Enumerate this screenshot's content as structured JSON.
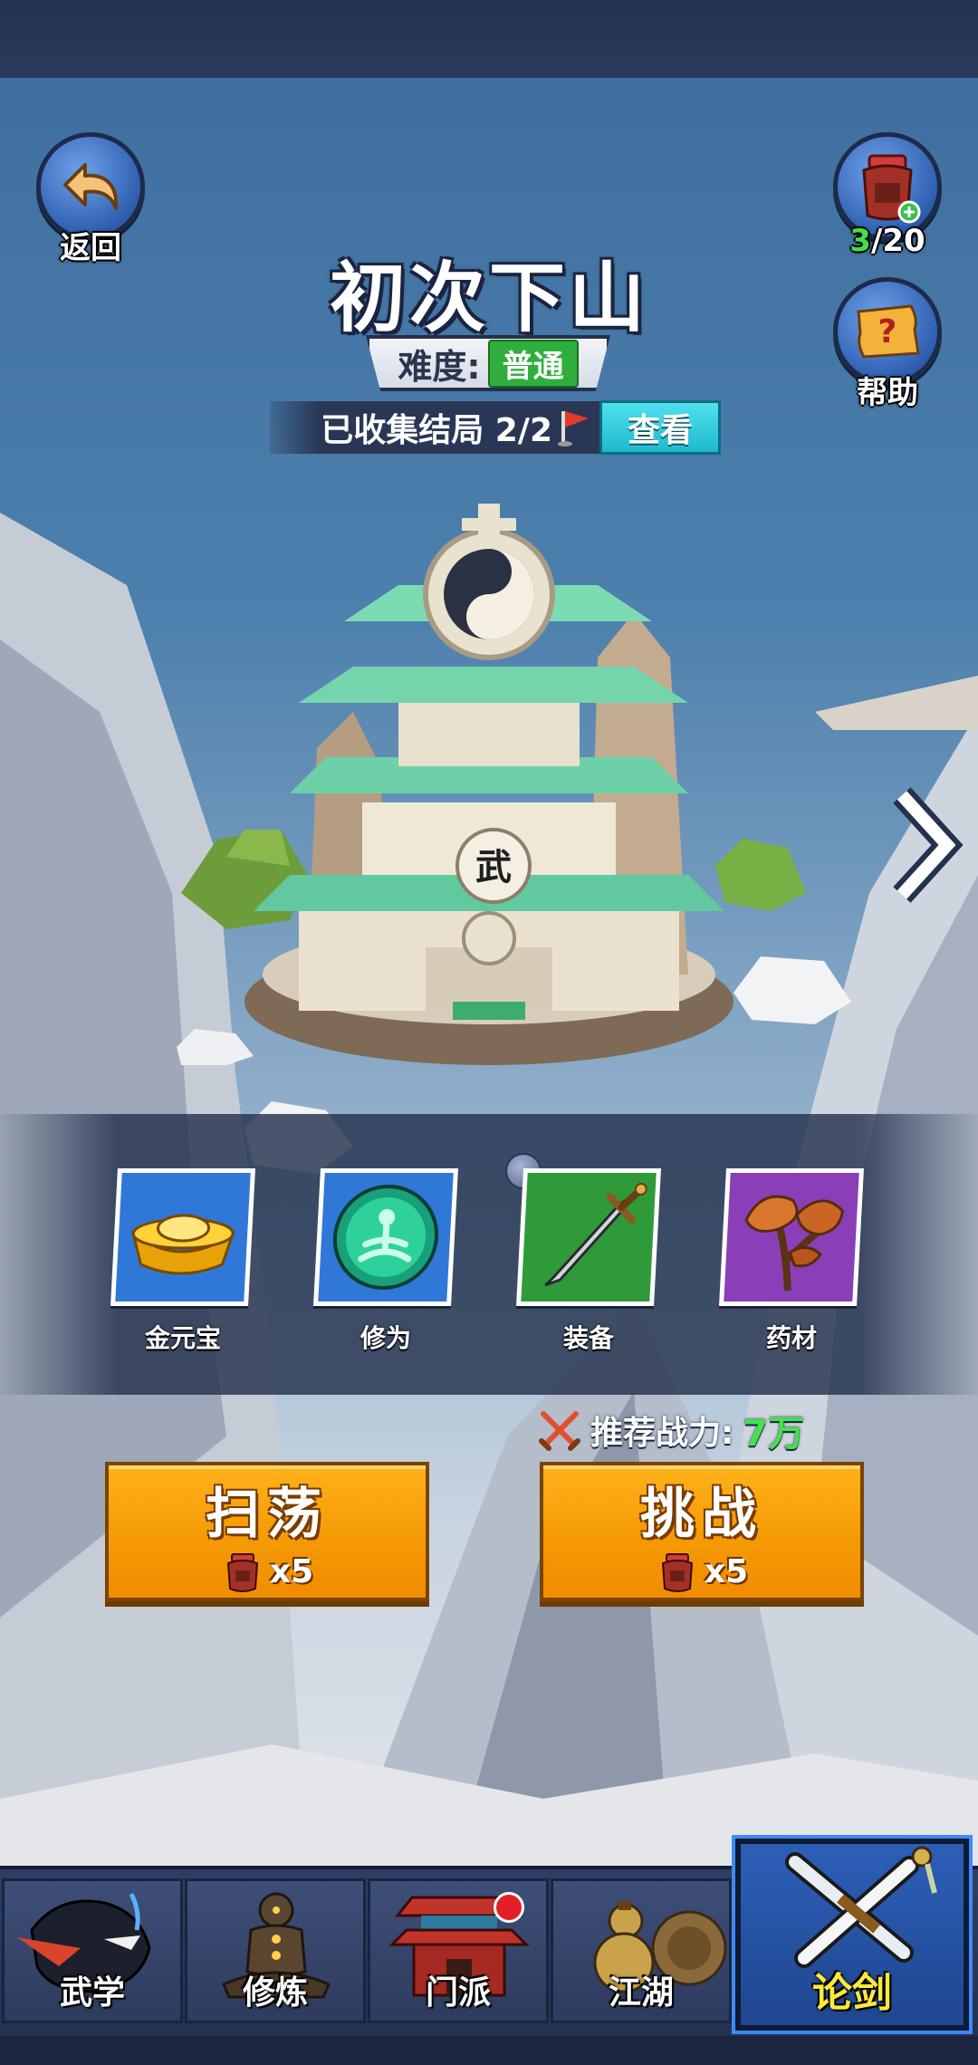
{
  "header": {
    "back_label": "返回",
    "stamina": {
      "current": "3",
      "max": "/20"
    },
    "help_label": "帮助"
  },
  "stage": {
    "title": "初次下山",
    "difficulty_label": "难度:",
    "difficulty_value": "普通",
    "collection_text": "已收集结局 2/2",
    "view_button": "查看",
    "temple_sign": "武"
  },
  "rewards": [
    {
      "name": "金元宝",
      "icon": "gold-ingot-icon",
      "bg": "#2f78d8"
    },
    {
      "name": "修为",
      "icon": "meditation-orb-icon",
      "bg": "#2f78d8"
    },
    {
      "name": "装备",
      "icon": "sword-icon",
      "bg": "#2f9a3a"
    },
    {
      "name": "药材",
      "icon": "herb-mushroom-icon",
      "bg": "#8a3fb8"
    }
  ],
  "recommend": {
    "label": "推荐战力:",
    "value": "7万"
  },
  "actions": {
    "sweep": {
      "label": "扫荡",
      "cost": "x5"
    },
    "challenge": {
      "label": "挑战",
      "cost": "x5"
    }
  },
  "nav": {
    "tabs": [
      {
        "label": "武学",
        "icon": "ninja-icon"
      },
      {
        "label": "修炼",
        "icon": "meditating-figure-icon"
      },
      {
        "label": "门派",
        "icon": "sect-gate-icon",
        "badge": true
      },
      {
        "label": "江湖",
        "icon": "gourd-icon"
      },
      {
        "label": "论剑",
        "icon": "crossed-swords-icon",
        "active": true
      }
    ]
  },
  "colors": {
    "accent_orange": "#f59a05",
    "power_green": "#45e04c",
    "view_cyan": "#1fb9cf",
    "nav_active_label": "#ffe93a"
  }
}
